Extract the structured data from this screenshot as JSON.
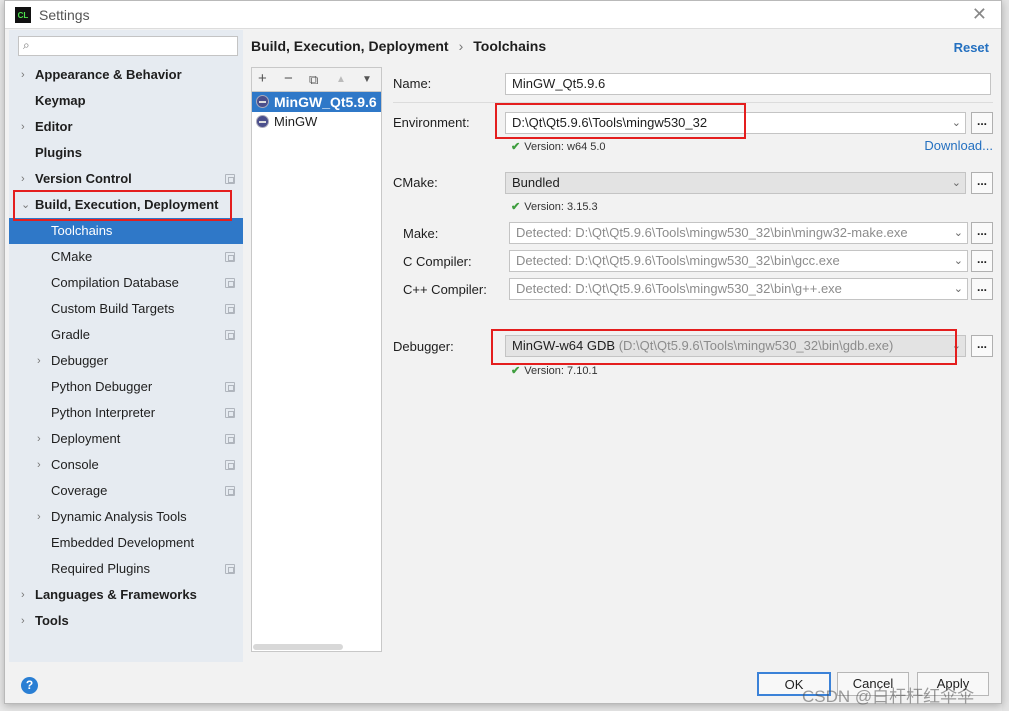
{
  "window": {
    "title": "Settings",
    "app_logo_text": "CL",
    "close_symbol": "✕"
  },
  "search": {
    "placeholder": "",
    "icon": "search-icon"
  },
  "tree": [
    {
      "label": "Appearance & Behavior",
      "level": 0,
      "bold": true,
      "arrow": "›"
    },
    {
      "label": "Keymap",
      "level": 0,
      "bold": true,
      "arrow": ""
    },
    {
      "label": "Editor",
      "level": 0,
      "bold": true,
      "arrow": "›"
    },
    {
      "label": "Plugins",
      "level": 0,
      "bold": true,
      "arrow": ""
    },
    {
      "label": "Version Control",
      "level": 0,
      "bold": true,
      "arrow": "›",
      "proj": true
    },
    {
      "label": "Build, Execution, Deployment",
      "level": 0,
      "bold": true,
      "arrow": "⌄"
    },
    {
      "label": "Toolchains",
      "level": 1,
      "selected": true,
      "arrow": ""
    },
    {
      "label": "CMake",
      "level": 1,
      "arrow": "",
      "proj": true
    },
    {
      "label": "Compilation Database",
      "level": 1,
      "arrow": "",
      "proj": true
    },
    {
      "label": "Custom Build Targets",
      "level": 1,
      "arrow": "",
      "proj": true
    },
    {
      "label": "Gradle",
      "level": 1,
      "arrow": "",
      "proj": true
    },
    {
      "label": "Debugger",
      "level": 1,
      "arrow": "›"
    },
    {
      "label": "Python Debugger",
      "level": 1,
      "arrow": "",
      "proj": true
    },
    {
      "label": "Python Interpreter",
      "level": 1,
      "arrow": "",
      "proj": true
    },
    {
      "label": "Deployment",
      "level": 1,
      "arrow": "›",
      "proj": true
    },
    {
      "label": "Console",
      "level": 1,
      "arrow": "›",
      "proj": true
    },
    {
      "label": "Coverage",
      "level": 1,
      "arrow": "",
      "proj": true
    },
    {
      "label": "Dynamic Analysis Tools",
      "level": 1,
      "arrow": "›"
    },
    {
      "label": "Embedded Development",
      "level": 1,
      "arrow": ""
    },
    {
      "label": "Required Plugins",
      "level": 1,
      "arrow": "",
      "proj": true
    },
    {
      "label": "Languages & Frameworks",
      "level": 0,
      "bold": true,
      "arrow": "›"
    },
    {
      "label": "Tools",
      "level": 0,
      "bold": true,
      "arrow": "›"
    }
  ],
  "breadcrumb": {
    "parent": "Build, Execution, Deployment",
    "separator": "›",
    "current": "Toolchains"
  },
  "reset_label": "Reset",
  "toolchain_toolbar": {
    "add": "+",
    "remove": "−",
    "copy": "⧉",
    "up": "▲",
    "down": "▼"
  },
  "toolchains": [
    {
      "label": "MinGW_Qt5.9.6 (",
      "selected": true
    },
    {
      "label": "MinGW",
      "selected": false
    }
  ],
  "form": {
    "name_label": "Name:",
    "name_value": "MinGW_Qt5.9.6",
    "env_label": "Environment:",
    "env_value": "D:\\Qt\\Qt5.9.6\\Tools\\mingw530_32",
    "env_version": "Version: w64 5.0",
    "download_label": "Download...",
    "cmake_label": "CMake:",
    "cmake_value": "Bundled",
    "cmake_version": "Version: 3.15.3",
    "make_label": "Make:",
    "make_value": "Detected: D:\\Qt\\Qt5.9.6\\Tools\\mingw530_32\\bin\\mingw32-make.exe",
    "c_label": "C Compiler:",
    "c_value": "Detected: D:\\Qt\\Qt5.9.6\\Tools\\mingw530_32\\bin\\gcc.exe",
    "cpp_label": "C++ Compiler:",
    "cpp_value": "Detected: D:\\Qt\\Qt5.9.6\\Tools\\mingw530_32\\bin\\g++.exe",
    "debugger_label": "Debugger:",
    "debugger_value": "MinGW-w64 GDB",
    "debugger_path": "(D:\\Qt\\Qt5.9.6\\Tools\\mingw530_32\\bin\\gdb.exe)",
    "debugger_version": "Version: 7.10.1",
    "browse_label": "...",
    "check_mark": "✔",
    "chevron": "⌄"
  },
  "buttons": {
    "help": "?",
    "ok": "OK",
    "cancel": "Cancel",
    "apply": "Apply"
  },
  "watermark": "CSDN @白杆杆红伞伞",
  "colors": {
    "selection": "#2f78c8",
    "link": "#2470c0",
    "highlight_box": "#e41e1e",
    "check": "#3f9e3f"
  }
}
